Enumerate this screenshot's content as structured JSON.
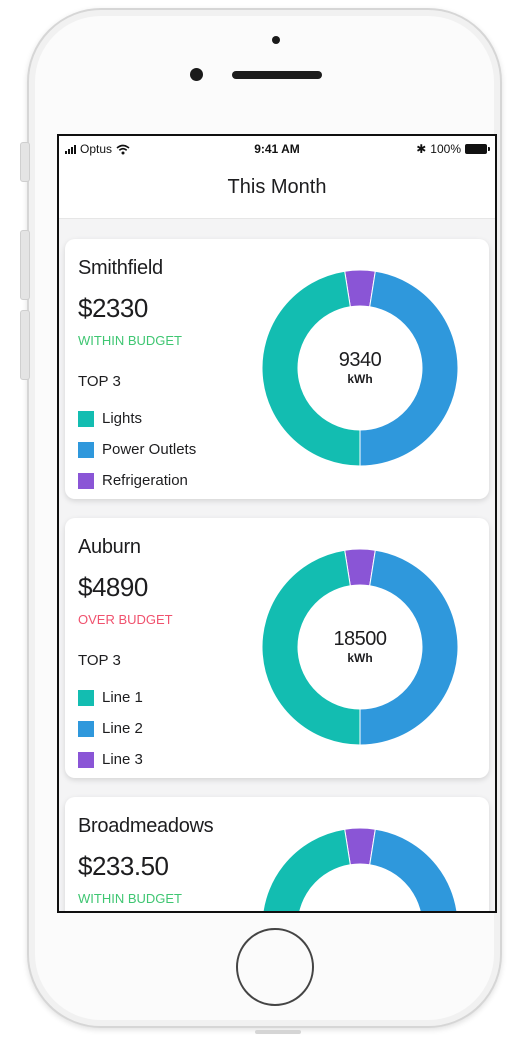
{
  "status_bar": {
    "carrier": "Optus",
    "time": "9:41 AM",
    "bluetooth": "✱",
    "battery": "100%"
  },
  "nav": {
    "title": "This Month"
  },
  "colors": {
    "lights": "#13bdb1",
    "power": "#2f98dc",
    "refrigeration": "#8a55d6",
    "within": "#3fc672",
    "over": "#f0526e"
  },
  "cards": [
    {
      "name": "Smithfield",
      "amount": "$2330",
      "status": "WITHIN BUDGET",
      "top_label": "TOP 3",
      "legend": [
        "Lights",
        "Power Outlets",
        "Refrigeration"
      ],
      "kwh_value": "9340",
      "kwh_unit": "kWh",
      "segments": [
        0.475,
        0.475,
        0.05
      ]
    },
    {
      "name": "Auburn",
      "amount": "$4890",
      "status": "OVER BUDGET",
      "top_label": "TOP 3",
      "legend": [
        "Line 1",
        "Line 2",
        "Line 3"
      ],
      "kwh_value": "18500",
      "kwh_unit": "kWh",
      "segments": [
        0.475,
        0.475,
        0.05
      ]
    },
    {
      "name": "Broadmeadows",
      "amount": "$233.50",
      "status": "WITHIN BUDGET",
      "segments": [
        0.475,
        0.475,
        0.05
      ]
    }
  ]
}
